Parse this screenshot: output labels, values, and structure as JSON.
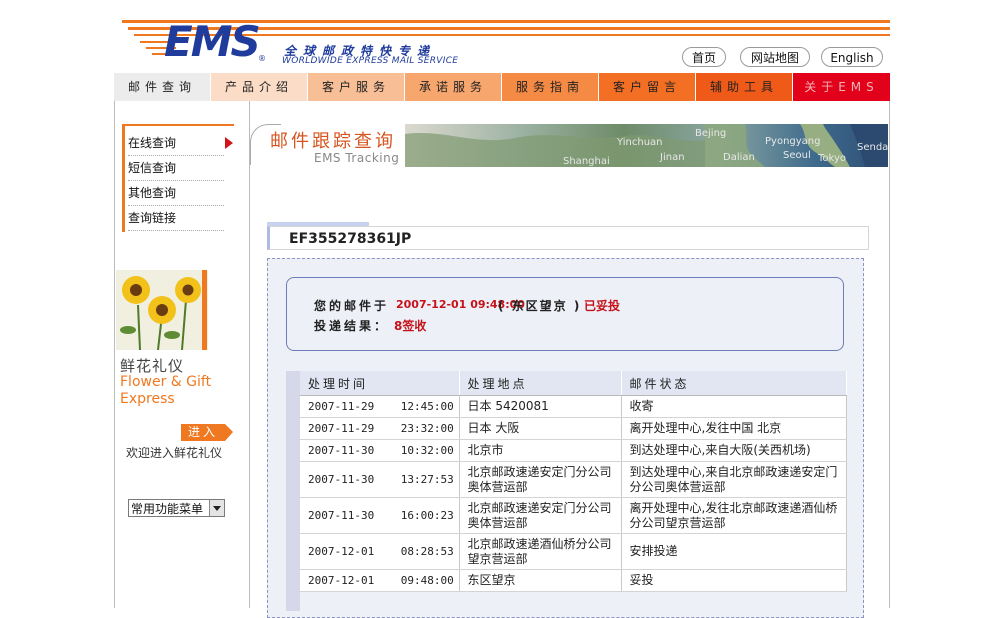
{
  "header": {
    "logo": "EMS",
    "logo_reg": "®",
    "slogan_cn": "全球邮政特快专递",
    "slogan_en": "WORLDWIDE EXPRESS MAIL SERVICE",
    "links": [
      "首页",
      "网站地图",
      "English"
    ]
  },
  "nav": {
    "items": [
      {
        "label": "邮件查询",
        "bg": "#ececec",
        "color": "#222"
      },
      {
        "label": "产品介绍",
        "bg": "#fbdcc6",
        "color": "#222"
      },
      {
        "label": "客户服务",
        "bg": "#f8bf97",
        "color": "#222"
      },
      {
        "label": "承诺服务",
        "bg": "#f7a66e",
        "color": "#222"
      },
      {
        "label": "服务指南",
        "bg": "#f58a45",
        "color": "#222"
      },
      {
        "label": "客户留言",
        "bg": "#f26f24",
        "color": "#222"
      },
      {
        "label": "辅助工具",
        "bg": "#ef5a19",
        "color": "#222"
      },
      {
        "label": "关于EMS",
        "bg": "#e3001b",
        "color": "#f3b4b4"
      }
    ]
  },
  "sidebar": {
    "items": [
      "在线查询",
      "短信查询",
      "其他查询",
      "查询链接"
    ],
    "promo_cn": "鲜花礼仪",
    "promo_en_1": "Flower & Gift",
    "promo_en_2": "Express",
    "enter": "进入",
    "welcome": "欢迎进入鲜花礼仪",
    "menu_select": "常用功能菜单"
  },
  "banner": {
    "title_cn": "邮件跟踪查询",
    "title_en": "EMS Tracking",
    "map_labels": [
      "Bejing",
      "Pyongyang",
      "Seoul",
      "Tokyo",
      "Sendai",
      "Yinchuan",
      "Shanghai",
      "Dalian",
      "Jinan"
    ]
  },
  "tracking": {
    "number": "EF355278361JP",
    "status_prefix": "您的邮件于",
    "status_datetime": "2007-12-01 09:48:00",
    "status_location": "( 东区望京 )",
    "status_result": "已妥投",
    "delivery_label": "投递结果：",
    "delivery_result": "8签收"
  },
  "table": {
    "headers": [
      "处理时间",
      "处理地点",
      "邮件状态"
    ],
    "rows": [
      {
        "date": "2007-11-29",
        "time": "12:45:00",
        "place": "日本 5420081",
        "status": "收寄"
      },
      {
        "date": "2007-11-29",
        "time": "23:32:00",
        "place": "日本 大阪",
        "status": "离开处理中心,发往中国 北京"
      },
      {
        "date": "2007-11-30",
        "time": "10:32:00",
        "place": "北京市",
        "status": "到达处理中心,来自大阪(关西机场)"
      },
      {
        "date": "2007-11-30",
        "time": "13:27:53",
        "place": "北京邮政速递安定门分公司奥体营运部",
        "status": "到达处理中心,来自北京邮政速递安定门分公司奥体营运部"
      },
      {
        "date": "2007-11-30",
        "time": "16:00:23",
        "place": "北京邮政速递安定门分公司奥体营运部",
        "status": "离开处理中心,发往北京邮政速递酒仙桥分公司望京营运部"
      },
      {
        "date": "2007-12-01",
        "time": "08:28:53",
        "place": "北京邮政速递酒仙桥分公司望京营运部",
        "status": "安排投递"
      },
      {
        "date": "2007-12-01",
        "time": "09:48:00",
        "place": "东区望京",
        "status": "妥投"
      }
    ]
  }
}
